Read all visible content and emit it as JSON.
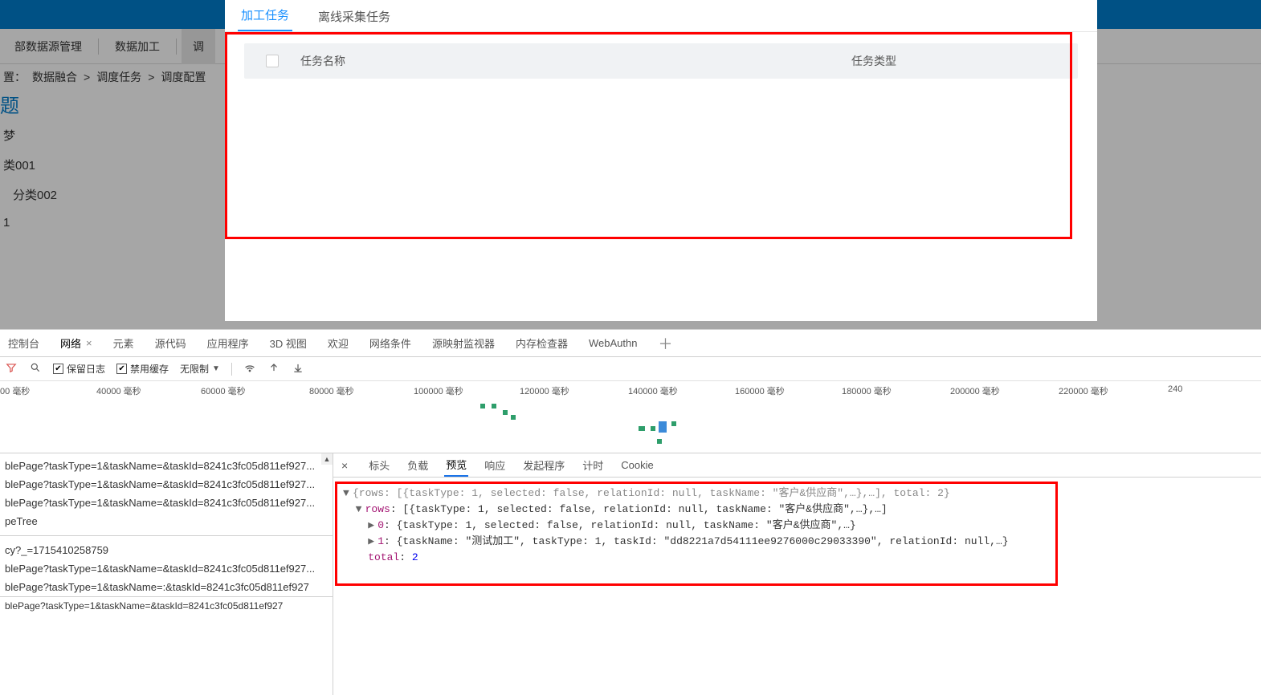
{
  "navs": {
    "item0": "部数据源管理",
    "item1": "数据加工",
    "item2": "调"
  },
  "breadcrumb": {
    "label": "置：",
    "p1": "数据融合",
    "sep": ">",
    "p2": "调度任务",
    "p3": "调度配置"
  },
  "pageTitleSuffix": "题",
  "tree": {
    "n0": "梦",
    "n1": "类001",
    "n2": "分类002",
    "n3": "1"
  },
  "modal": {
    "tabs": {
      "active": "加工任务",
      "other": "离线采集任务"
    },
    "th": {
      "name": "任务名称",
      "type": "任务类型"
    }
  },
  "devtools": {
    "tabs": {
      "console": "控制台",
      "network": "网络",
      "elements": "元素",
      "sources": "源代码",
      "application": "应用程序",
      "view3d": "3D 视图",
      "welcome": "欢迎",
      "netcond": "网络条件",
      "sourcemap": "源映射监视器",
      "memory": "内存检查器",
      "webauthn": "WebAuthn"
    },
    "toolbar": {
      "preserveLog": "保留日志",
      "disableCache": "禁用缓存",
      "throttle": "无限制"
    },
    "timeline": {
      "unit": "毫秒",
      "ticks": [
        "00",
        "40000",
        "60000",
        "80000",
        "100000",
        "120000",
        "140000",
        "160000",
        "180000",
        "200000",
        "220000",
        "240"
      ]
    },
    "requests": {
      "r0": "blePage?taskType=1&taskName=&taskId=8241c3fc05d811ef927...",
      "r1": "blePage?taskType=1&taskName=&taskId=8241c3fc05d811ef927...",
      "r2": "blePage?taskType=1&taskName=&taskId=8241c3fc05d811ef927...",
      "r3": "peTree",
      "r4": "cy?_=1715410258759",
      "r5": "blePage?taskType=1&taskName=&taskId=8241c3fc05d811ef927...",
      "r6": "blePage?taskType=1&taskName=:&taskId=8241c3fc05d811ef927",
      "rbottom": "blePage?taskType=1&taskName=&taskId=8241c3fc05d811ef927"
    },
    "detailTabs": {
      "headers": "标头",
      "payload": "负载",
      "preview": "预览",
      "response": "响应",
      "initiator": "发起程序",
      "timing": "计时",
      "cookie": "Cookie"
    },
    "preview": {
      "line0a": "{rows: [{taskType: 1, selected: false, relationId: null, taskName: \"客户&供应商\",…},…], total: 2}",
      "rowsKey": "rows",
      "line1b": ": [{taskType: 1, selected: false, relationId: null, taskName: \"客户&供应商\",…},…]",
      "idx0": "0",
      "line2b": ": {taskType: 1, selected: false, relationId: null, taskName: \"客户&供应商\",…}",
      "idx1": "1",
      "line3b": ": {taskName: \"测试加工\", taskType: 1, taskId: \"dd8221a7d54111ee9276000c29033390\", relationId: null,…}",
      "totalKey": "total",
      "totalSep": ": ",
      "totalVal": "2"
    }
  }
}
